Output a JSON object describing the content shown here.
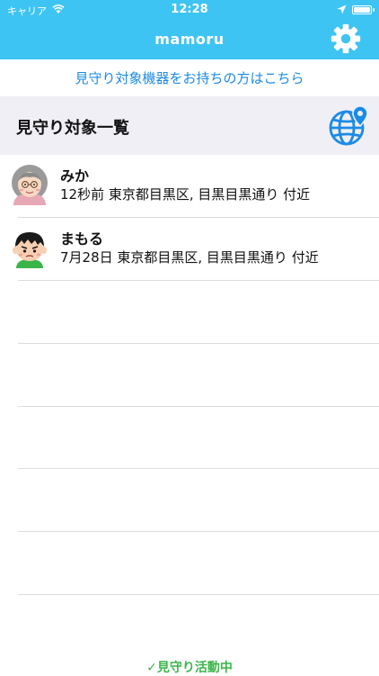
{
  "status_bar": {
    "carrier": "キャリア",
    "time": "12:28"
  },
  "app": {
    "title": "mamoru",
    "accent": "#3ec4f3"
  },
  "device_link": "見守り対象機器をお持ちの方はこちら",
  "section": {
    "title": "見守り対象一覧"
  },
  "icons": [
    "wifi-icon",
    "location-arrow-icon",
    "battery-icon",
    "gear-icon",
    "globe-pin-icon",
    "grandma-avatar-icon",
    "boy-avatar-icon",
    "checkmark-icon"
  ],
  "people": [
    {
      "name": "みか",
      "status": "12秒前 東京都目黒区, 目黒目黒通り 付近"
    },
    {
      "name": "まもる",
      "status": "7月28日 東京都目黒区, 目黒目黒通り 付近"
    }
  ],
  "footer": {
    "check": "✓",
    "text": "見守り活動中",
    "color": "#3bb54a"
  }
}
